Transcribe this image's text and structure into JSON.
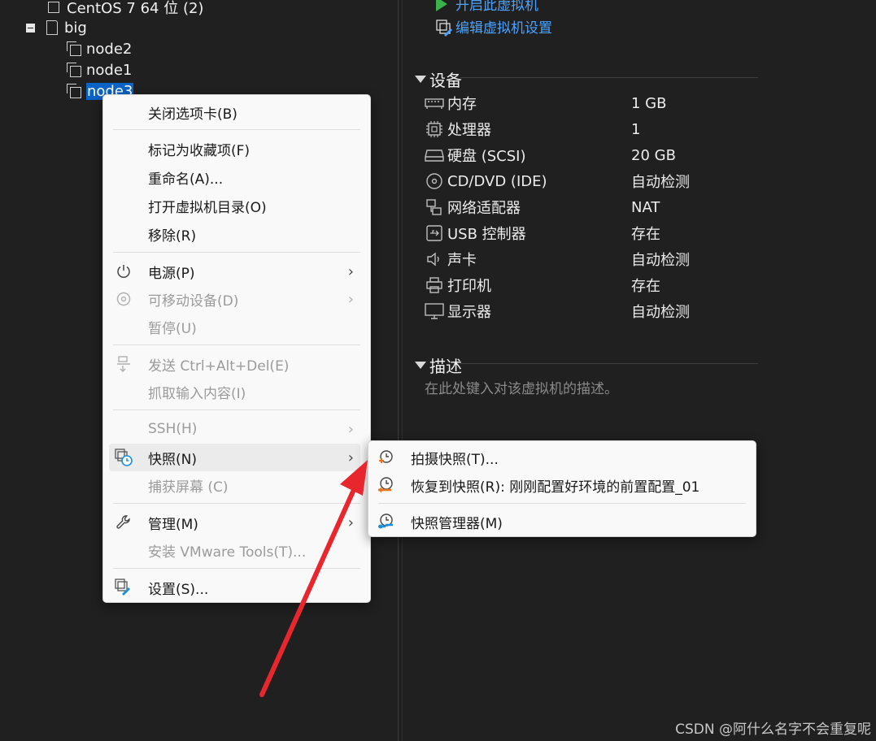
{
  "tree": {
    "items": [
      {
        "label": "CentOS 7 64 位 (2)"
      },
      {
        "label": "big"
      },
      {
        "label": "node2"
      },
      {
        "label": "node1"
      },
      {
        "label": "node3"
      }
    ]
  },
  "details": {
    "actions": [
      {
        "label": "开启此虚拟机"
      },
      {
        "label": "编辑虚拟机设置"
      }
    ],
    "devices_title": "设备",
    "devices": [
      {
        "name": "内存",
        "value": "1 GB",
        "icon": "memory-icon"
      },
      {
        "name": "处理器",
        "value": "1",
        "icon": "cpu-icon"
      },
      {
        "name": "硬盘 (SCSI)",
        "value": "20 GB",
        "icon": "hard-disk-icon"
      },
      {
        "name": "CD/DVD (IDE)",
        "value": "自动检测",
        "icon": "cd-dvd-icon"
      },
      {
        "name": "网络适配器",
        "value": "NAT",
        "icon": "network-adapter-icon"
      },
      {
        "name": "USB 控制器",
        "value": "存在",
        "icon": "usb-icon"
      },
      {
        "name": "声卡",
        "value": "自动检测",
        "icon": "speaker-icon"
      },
      {
        "name": "打印机",
        "value": "存在",
        "icon": "printer-icon"
      },
      {
        "name": "显示器",
        "value": "自动检测",
        "icon": "monitor-icon"
      }
    ],
    "description_title": "描述",
    "description_placeholder": "在此处键入对该虚拟机的描述。"
  },
  "context_menu": {
    "items": {
      "close_tab": "关闭选项卡(B)",
      "mark_favorite": "标记为收藏项(F)",
      "rename": "重命名(A)...",
      "open_dir": "打开虚拟机目录(O)",
      "remove": "移除(R)",
      "power": "电源(P)",
      "removable_devices": "可移动设备(D)",
      "pause": "暂停(U)",
      "send_cad": "发送 Ctrl+Alt+Del(E)",
      "grab_input": "抓取输入内容(I)",
      "ssh": "SSH(H)",
      "snapshot": "快照(N)",
      "capture_screen": "捕获屏幕 (C)",
      "manage": "管理(M)",
      "install_tools": "安装 VMware Tools(T)...",
      "settings": "设置(S)..."
    }
  },
  "snapshot_submenu": {
    "take": "拍摄快照(T)...",
    "revert": "恢复到快照(R): 刚刚配置好环境的前置配置_01",
    "manager": "快照管理器(M)"
  },
  "colors": {
    "accent_link": "#4aa3ff",
    "selection": "#0a64c8",
    "annotation_arrow": "#e8262d"
  },
  "watermark": "CSDN @阿什么名字不会重复呢"
}
